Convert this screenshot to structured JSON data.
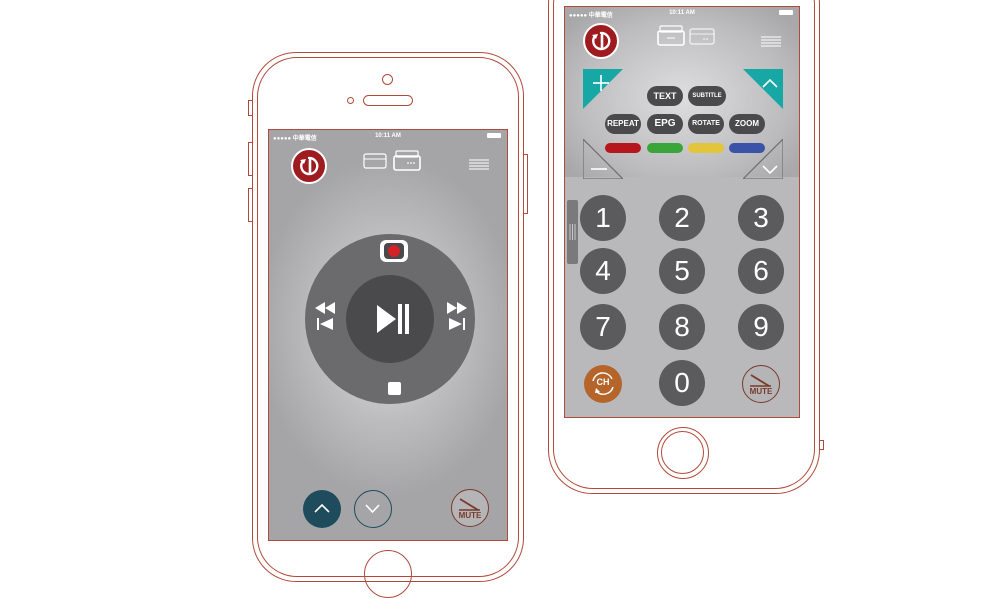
{
  "left_phone": {
    "status": {
      "carrier": "●●●●● 中華電信",
      "time": "10:11 AM"
    },
    "transport": {
      "record": "record",
      "play_pause": "play-pause",
      "stop": "stop",
      "rewind": "rewind",
      "fast_forward": "fast-forward"
    },
    "bottom": {
      "mute_label": "MUTE"
    }
  },
  "right_phone": {
    "status": {
      "carrier": "●●●●● 中華電信",
      "time": "10:11 AM"
    },
    "pills": {
      "text": "TEXT",
      "subtitle": "SUBTITLE",
      "repeat": "REPEAT",
      "epg": "EPG",
      "rotate": "ROTATE",
      "zoom": "ZOOM"
    },
    "colors": [
      "#b5171c",
      "#3aa63a",
      "#e2c53a",
      "#3a52a8"
    ],
    "keypad": [
      "1",
      "2",
      "3",
      "4",
      "5",
      "6",
      "7",
      "8",
      "9",
      "0"
    ],
    "ch_label": "CH",
    "mute_label": "MUTE"
  },
  "accent": {
    "power": "#9e1b1f",
    "teal": "#17a8a6",
    "outline": "#b14a3a",
    "dark_teal": "#1e4c5c",
    "ch_orange": "#b5652a"
  }
}
